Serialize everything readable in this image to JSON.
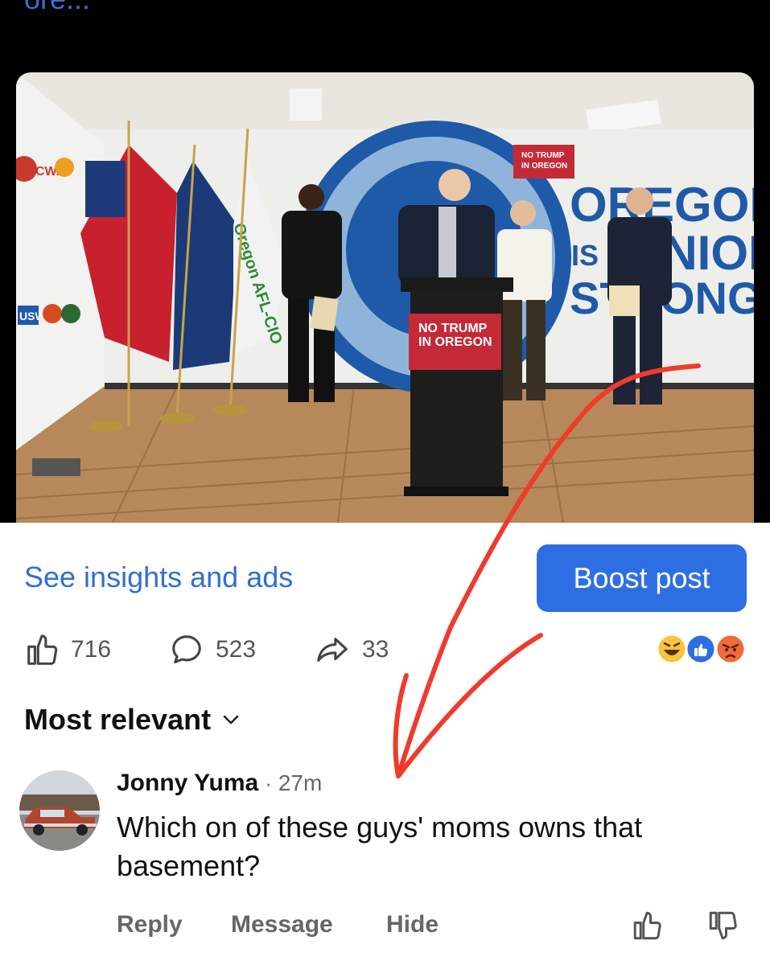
{
  "header": {
    "truncated_text": "ore..."
  },
  "photo": {
    "podium_sign_line1": "NO TRUMP",
    "podium_sign_line2": "IN OREGON",
    "wall_sign_line1": "NO TRUMP",
    "wall_sign_line2": "IN OREGON",
    "wall_text_line1": "OREGON",
    "wall_text_line2": "IS",
    "wall_text_line2b": "UNION",
    "wall_text_line3": "STRONG",
    "flag_banner_text": "Oregon AFL-CIO",
    "logo_cwa": "CWA",
    "logo_usw": "USW"
  },
  "actions": {
    "insights_label": "See insights and ads",
    "boost_label": "Boost post"
  },
  "stats": {
    "likes": "716",
    "comments": "523",
    "shares": "33"
  },
  "reactions": [
    "laugh-emoji",
    "like-emoji",
    "angry-emoji"
  ],
  "sort": {
    "label": "Most relevant"
  },
  "comment": {
    "author": "Jonny Yuma",
    "separator": "·",
    "time": "27m",
    "text": "Which on of these guys' moms owns that basement?",
    "reply_label": "Reply",
    "message_label": "Message",
    "hide_label": "Hide"
  },
  "colors": {
    "accent": "#2d6fe3",
    "link": "#2f6fd6",
    "annotation_arrow": "#ef3b2d"
  }
}
